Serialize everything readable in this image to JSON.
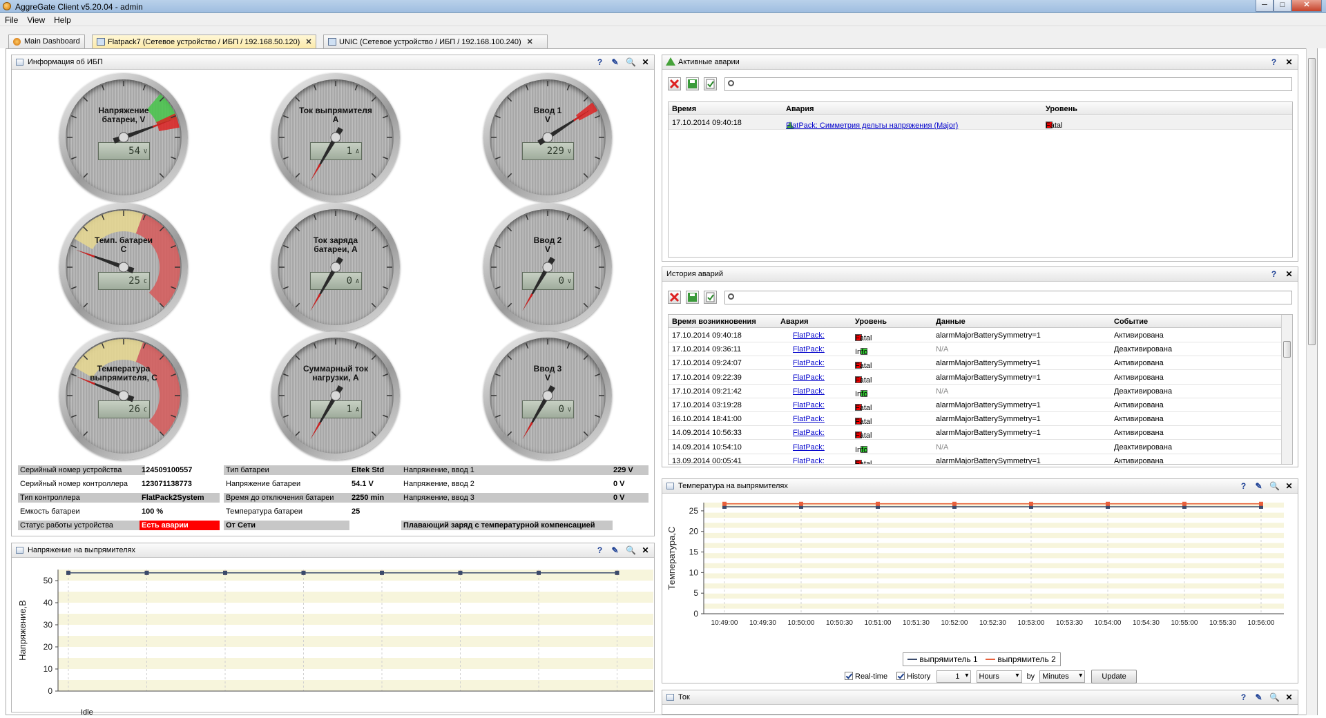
{
  "window": {
    "title": "AggreGate Client v5.20.04 - admin",
    "controls": [
      "─",
      "□",
      "✕"
    ]
  },
  "menu": [
    "File",
    "View",
    "Help"
  ],
  "tabs": [
    {
      "label": "Main Dashboard",
      "closable": false
    },
    {
      "label": "Flatpack7 (Сетевое устройство / ИБП / 192.168.50.120)",
      "closable": true
    },
    {
      "label": "UNIC (Сетевое устройство / ИБП / 192.168.100.240)",
      "closable": true
    }
  ],
  "panel_buttons": {
    "help": "?",
    "edit": "✎",
    "zoom": "🔍",
    "close": "✕"
  },
  "ups_panel": {
    "title": "Информация об ИБП",
    "gauges": [
      {
        "label1": "Напряжение",
        "label2": "батареи, V",
        "value": "54",
        "unit": "V"
      },
      {
        "label1": "Ток выпрямителя",
        "label2": "A",
        "value": "1",
        "unit": "A"
      },
      {
        "label1": "Ввод 1",
        "label2": "V",
        "value": "229",
        "unit": "V"
      },
      {
        "label1": "Темп. батареи",
        "label2": "C",
        "value": "25",
        "unit": "C"
      },
      {
        "label1": "Ток заряда",
        "label2": "батареи, А",
        "value": "0",
        "unit": "A"
      },
      {
        "label1": "Ввод 2",
        "label2": "V",
        "value": "0",
        "unit": "V"
      },
      {
        "label1": "Температура",
        "label2": "выпрямителя, С",
        "value": "26",
        "unit": "C"
      },
      {
        "label1": "Суммарный ток",
        "label2": "нагрузки, А",
        "value": "1",
        "unit": "A"
      },
      {
        "label1": "Ввод 3",
        "label2": "V",
        "value": "0",
        "unit": "V"
      }
    ],
    "info": {
      "serial_device_label": "Серийный номер устройства",
      "serial_device": "124509100557",
      "serial_ctrl_label": "Серийный номер контроллера",
      "serial_ctrl": "123071138773",
      "ctrl_type_label": "Тип контроллера",
      "ctrl_type": "FlatPack2System",
      "capacity_label": "Емкость батареи",
      "capacity": "100 %",
      "status_label": "Статус работы устройства",
      "status": "Есть аварии",
      "bat_type_label": "Тип батареи",
      "bat_type": "Eltek Std",
      "bat_voltage_label": "Напряжение батареи",
      "bat_voltage": "54.1 V",
      "runtime_label": "Время до отключения батареи",
      "runtime": "2250 min",
      "bat_temp_label": "Температура батареи",
      "bat_temp": "25",
      "mains_status": "От Сети",
      "in1_label": "Напряжение, ввод 1",
      "in1": "229 V",
      "in2_label": "Напряжение, ввод 2",
      "in2": "0 V",
      "in3_label": "Напряжение, ввод 3",
      "in3": "0 V",
      "mode": "Плавающий заряд с температурной компенсацией"
    }
  },
  "voltage_panel": {
    "title": "Напряжение на выпрямителях",
    "status": "Idle"
  },
  "active_alarms": {
    "title": "Активные аварии",
    "columns": [
      "Время",
      "Авария",
      "Уровень"
    ],
    "rows": [
      {
        "time": "17.10.2014 09:40:18",
        "alarm": "FlatPack: Симметрия дельты напряжения (Major)",
        "level": "Fatal"
      }
    ]
  },
  "alarm_history": {
    "title": "История аварий",
    "columns": [
      "Время возникновения",
      "Авария",
      "Уровень",
      "Данные",
      "Событие"
    ],
    "rows": [
      {
        "time": "17.10.2014 09:40:18",
        "alarm": "FlatPack:",
        "level": "Fatal",
        "data": "alarmMajorBatterySymmetry=1",
        "event": "Активирована"
      },
      {
        "time": "17.10.2014 09:36:11",
        "alarm": "FlatPack:",
        "level": "Info",
        "data": "N/A",
        "event": "Деактивирована"
      },
      {
        "time": "17.10.2014 09:24:07",
        "alarm": "FlatPack:",
        "level": "Fatal",
        "data": "alarmMajorBatterySymmetry=1",
        "event": "Активирована"
      },
      {
        "time": "17.10.2014 09:22:39",
        "alarm": "FlatPack:",
        "level": "Fatal",
        "data": "alarmMajorBatterySymmetry=1",
        "event": "Активирована"
      },
      {
        "time": "17.10.2014 09:21:42",
        "alarm": "FlatPack:",
        "level": "Info",
        "data": "N/A",
        "event": "Деактивирована"
      },
      {
        "time": "17.10.2014 03:19:28",
        "alarm": "FlatPack:",
        "level": "Fatal",
        "data": "alarmMajorBatterySymmetry=1",
        "event": "Активирована"
      },
      {
        "time": "16.10.2014 18:41:00",
        "alarm": "FlatPack:",
        "level": "Fatal",
        "data": "alarmMajorBatterySymmetry=1",
        "event": "Активирована"
      },
      {
        "time": "14.09.2014 10:56:33",
        "alarm": "FlatPack:",
        "level": "Fatal",
        "data": "alarmMajorBatterySymmetry=1",
        "event": "Активирована"
      },
      {
        "time": "14.09.2014 10:54:10",
        "alarm": "FlatPack:",
        "level": "Info",
        "data": "N/A",
        "event": "Деактивирована"
      },
      {
        "time": "13.09.2014 00:05:41",
        "alarm": "FlatPack:",
        "level": "Fatal",
        "data": "alarmMajorBatterySymmetry=1",
        "event": "Активирована"
      }
    ]
  },
  "temp_panel": {
    "title": "Температура на выпрямителях",
    "controls": {
      "realtime": "Real-time",
      "history": "History",
      "amount": "1",
      "unit": "Hours",
      "by": "by",
      "by_unit": "Minutes",
      "update": "Update"
    }
  },
  "current_panel": {
    "title": "Ток"
  },
  "colors": {
    "series1": "#3a4a6b",
    "series2": "#e8603c",
    "fatal": "#e00000",
    "info": "#33cc33"
  },
  "chart_data": [
    {
      "type": "line",
      "ylabel": "Напряжение,В",
      "ylim": [
        0,
        55
      ],
      "yticks": [
        0,
        10,
        20,
        30,
        40,
        50
      ],
      "x": [
        1,
        2,
        3,
        4,
        5,
        6,
        7,
        8
      ],
      "series": [
        {
          "values": [
            53.5,
            53.5,
            53.5,
            53.5,
            53.5,
            53.5,
            53.5,
            53.5
          ]
        },
        {
          "values": [
            53.5,
            53.5,
            53.5,
            53.5,
            53.5,
            53.5,
            53.5,
            53.5
          ]
        }
      ]
    },
    {
      "type": "line",
      "ylabel": "Температура,С",
      "ylim": [
        0,
        27
      ],
      "yticks": [
        0,
        5,
        10,
        15,
        20,
        25
      ],
      "categories": [
        "10:49:00",
        "10:49:30",
        "10:50:00",
        "10:50:30",
        "10:51:00",
        "10:51:30",
        "10:52:00",
        "10:52:30",
        "10:53:00",
        "10:53:30",
        "10:54:00",
        "10:54:30",
        "10:55:00",
        "10:55:30",
        "10:56:00"
      ],
      "point_labels": [
        "10:49:00",
        "10:50:00",
        "10:51:00",
        "10:52:00",
        "10:53:00",
        "10:54:00",
        "10:55:00",
        "10:56:00"
      ],
      "series": [
        {
          "name": "выпрямитель 1",
          "values": [
            26,
            26,
            26,
            26,
            26,
            26,
            26,
            26
          ]
        },
        {
          "name": "выпрямитель 2",
          "values": [
            26.7,
            26.7,
            26.7,
            26.7,
            26.7,
            26.7,
            26.7,
            26.7
          ]
        }
      ]
    }
  ]
}
